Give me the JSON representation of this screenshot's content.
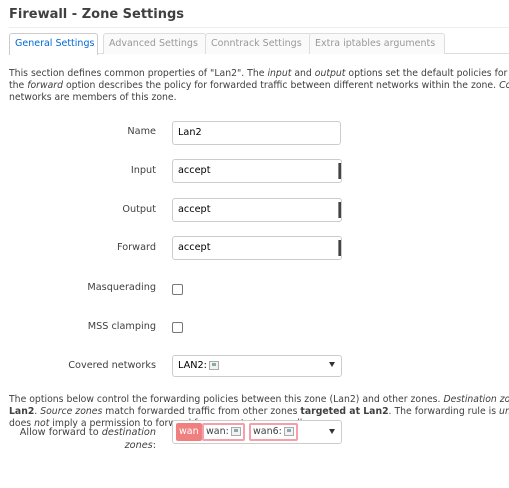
{
  "page": {
    "title": "Firewall - Zone Settings"
  },
  "tabs": [
    {
      "label": "General Settings",
      "active": true
    },
    {
      "label": "Advanced Settings",
      "active": false
    },
    {
      "label": "Conntrack Settings",
      "active": false
    },
    {
      "label": "Extra iptables arguments",
      "active": false
    }
  ],
  "intro": {
    "line1_a": "This section defines common properties of \"Lan2\". The ",
    "line1_i1": "input",
    "line1_b": " and ",
    "line1_i2": "output",
    "line1_c": " options set the default policies for tr",
    "line2_a": "the ",
    "line2_i": "forward",
    "line2_b": " option describes the policy for forwarded traffic between different networks within the zone. ",
    "line2_i2": "Cove",
    "line3": "networks are members of this zone."
  },
  "form": {
    "name_label": "Name",
    "name_value": "Lan2",
    "input_label": "Input",
    "input_value": "accept",
    "output_label": "Output",
    "output_value": "accept",
    "forward_label": "Forward",
    "forward_value": "accept",
    "masq_label": "Masquerading",
    "mss_label": "MSS clamping",
    "covered_label": "Covered networks",
    "covered_value": "LAN2:"
  },
  "forward_desc": {
    "l1_a": "The options below control the forwarding policies between this zone (Lan2) and other zones. ",
    "l1_i": "Destination zo",
    "l2_b1": "Lan2",
    "l2_a": ". ",
    "l2_i": "Source zones",
    "l2_c": " match forwarded traffic from other zones ",
    "l2_b2": "targeted at Lan2",
    "l2_d": ". The forwarding rule is ",
    "l2_i2": "unid",
    "l3_a": "does ",
    "l3_i": "not",
    "l3_b": " imply a permission to forward from wan to lan as well."
  },
  "allow_forward": {
    "label_a": "Allow forward to ",
    "label_i1": "destination",
    "label_i2": "zones",
    "label_colon": ":",
    "chips": [
      "wan",
      "wan:",
      "wan6:"
    ]
  }
}
